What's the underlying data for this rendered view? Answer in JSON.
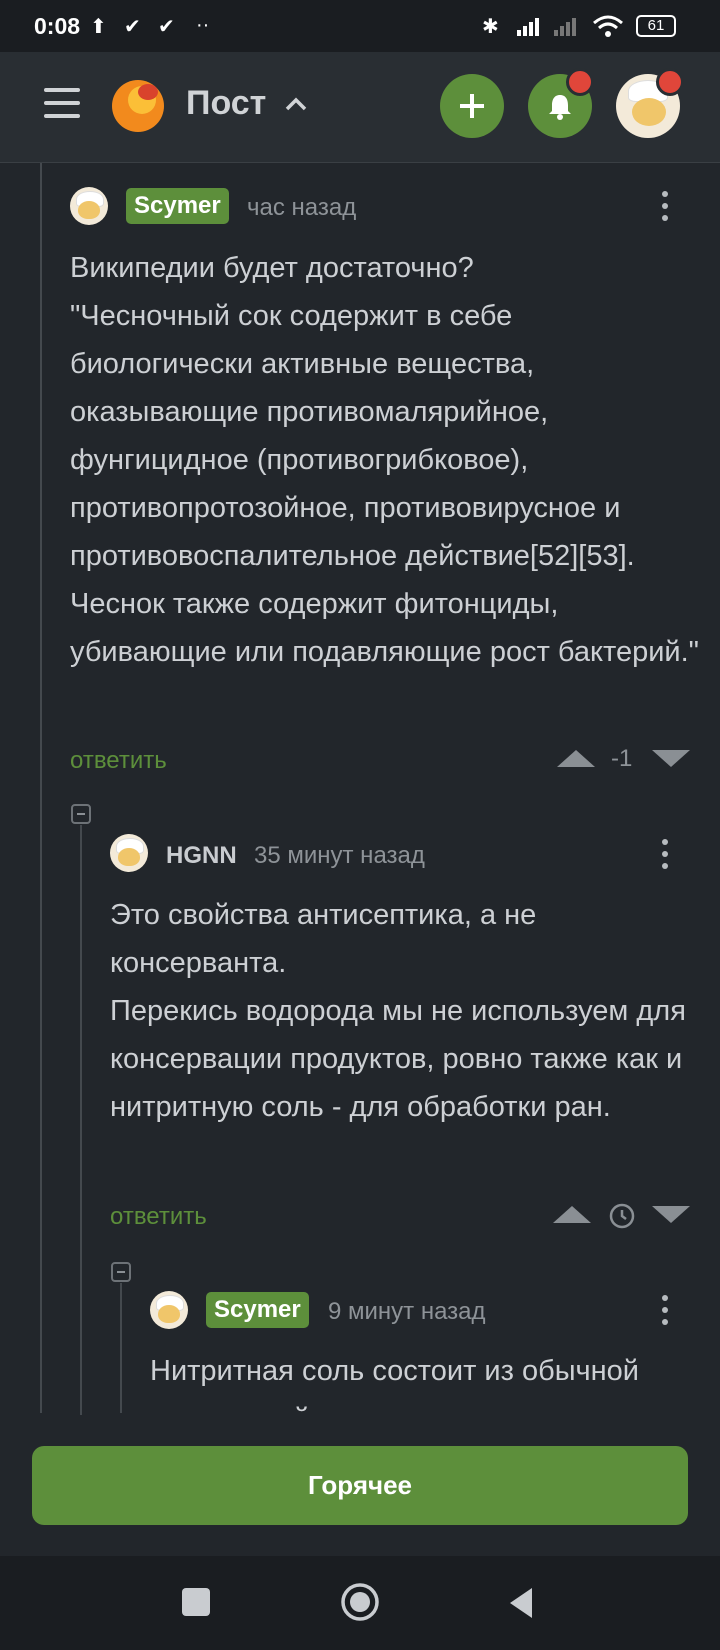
{
  "status_bar": {
    "time": "0:08",
    "battery": "61",
    "icons": [
      "upload-icon",
      "check-icon",
      "check-icon",
      "more-dots-icon",
      "bluetooth-icon",
      "signal-icon",
      "signal-icon",
      "wifi-icon",
      "battery-icon"
    ]
  },
  "header": {
    "title": "Пост",
    "logo": "pikabu-logo-icon",
    "buttons": [
      "menu-icon",
      "plus-icon",
      "bell-icon",
      "avatar"
    ],
    "accent": "#5d8f3b",
    "notification_color": "#e0463a"
  },
  "comments": [
    {
      "author": "Scymer",
      "author_badge": true,
      "time": "час назад",
      "text": "Википедии будет достаточно?\n\"Чесночный сок содержит в себе биологически активные вещества, оказывающие противомалярийное, фунгицидное (противогрибковое), противопротозойное, противовирусное и противовоспалительное действие[52][53]. Чеснок также содержит фитонциды, убивающие или подавляющие рост бактерий.\"",
      "reply_label": "ответить",
      "rating": "-1"
    },
    {
      "author": "HGNN",
      "author_badge": false,
      "time": "35 минут назад",
      "text": "Это свойства антисептика, а не консерванта.\nПерекись водорода мы не используем для консервации продуктов, ровно также как и нитритную соль - для обработки ран.",
      "reply_label": "ответить",
      "rating_icon": "clock-icon"
    },
    {
      "author": "Scymer",
      "author_badge": true,
      "time": "9 минут назад",
      "text": "Нитритная соль состоит из обычной поваренной соли с"
    }
  ],
  "hot_button": "Горячее",
  "nav": [
    "square-icon",
    "circle-home-icon",
    "back-triangle-icon"
  ]
}
